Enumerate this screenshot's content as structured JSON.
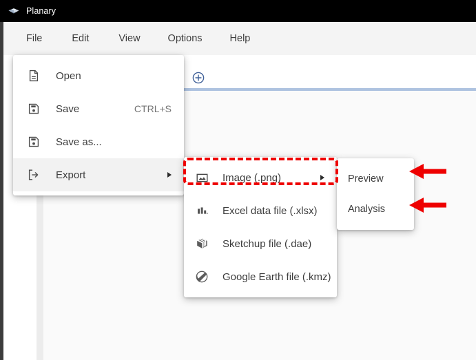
{
  "window": {
    "title": "Planary",
    "app_icon": "gem-icon"
  },
  "menubar": {
    "items": [
      {
        "label": "File",
        "name": "menubar-item-file",
        "active": true
      },
      {
        "label": "Edit",
        "name": "menubar-item-edit",
        "active": false
      },
      {
        "label": "View",
        "name": "menubar-item-view",
        "active": false
      },
      {
        "label": "Options",
        "name": "menubar-item-options",
        "active": false
      },
      {
        "label": "Help",
        "name": "menubar-item-help",
        "active": false
      }
    ]
  },
  "tabstrip": {
    "add_tab_icon": "plus-circle-icon",
    "active_tab_color": "#a7bcd9",
    "underline_color": "#aec3e0"
  },
  "file_menu": {
    "items": [
      {
        "label": "Open",
        "icon": "document-icon",
        "shortcut": "",
        "submenu": false,
        "highlighted": false
      },
      {
        "label": "Save",
        "icon": "floppy-disk-icon",
        "shortcut": "CTRL+S",
        "submenu": false,
        "highlighted": false
      },
      {
        "label": "Save as...",
        "icon": "floppy-disk-icon",
        "shortcut": "",
        "submenu": false,
        "highlighted": false
      },
      {
        "label": "Export",
        "icon": "export-arrow-icon",
        "shortcut": "",
        "submenu": true,
        "highlighted": true
      }
    ]
  },
  "export_menu": {
    "items": [
      {
        "label": "Image (.png)",
        "icon": "image-icon",
        "submenu": true,
        "highlighted": true
      },
      {
        "label": "Excel data file (.xlsx)",
        "icon": "bar-chart-icon",
        "submenu": false,
        "highlighted": false
      },
      {
        "label": "Sketchup file (.dae)",
        "icon": "sketchup-icon",
        "submenu": false,
        "highlighted": false
      },
      {
        "label": "Google Earth file (.kmz)",
        "icon": "google-earth-icon",
        "submenu": false,
        "highlighted": false
      }
    ]
  },
  "image_menu": {
    "items": [
      {
        "label": "Preview",
        "highlighted": false
      },
      {
        "label": "Analysis",
        "highlighted": false
      }
    ]
  },
  "annotations": {
    "highlight_color": "#ee0000",
    "box_target": "Image (.png)",
    "arrows": [
      {
        "name": "arrow-preview",
        "points_to": "Preview",
        "direction": "left"
      },
      {
        "name": "arrow-analysis",
        "points_to": "Analysis",
        "direction": "left"
      }
    ]
  }
}
